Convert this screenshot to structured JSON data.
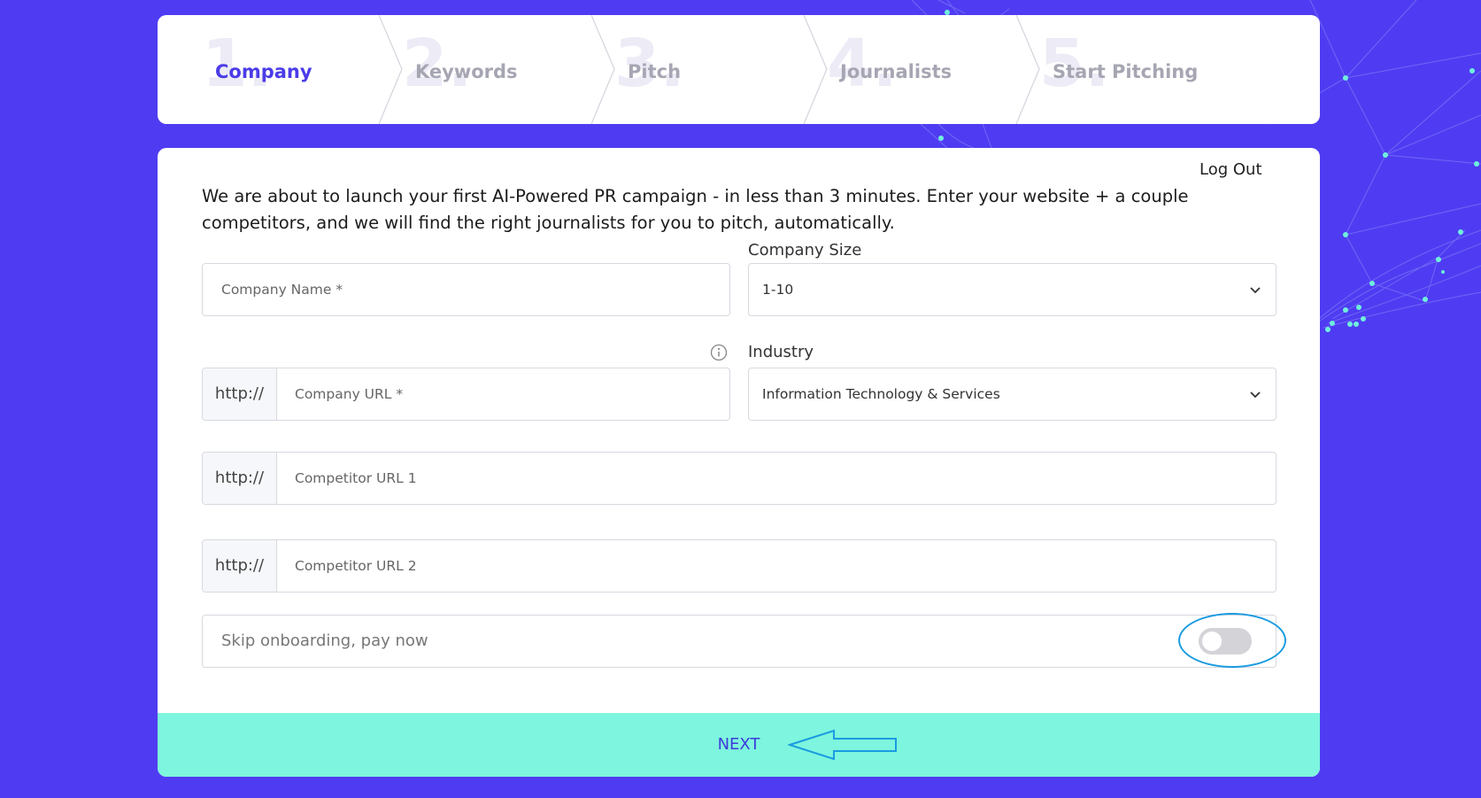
{
  "stepper": {
    "steps": [
      {
        "number": "1.",
        "label": "Company"
      },
      {
        "number": "2.",
        "label": "Keywords"
      },
      {
        "number": "3.",
        "label": "Pitch"
      },
      {
        "number": "4.",
        "label": "Journalists"
      },
      {
        "number": "5.",
        "label": "Start Pitching"
      }
    ],
    "active_step": "Company"
  },
  "header": {
    "logout_label": "Log Out"
  },
  "intro": {
    "text": "We are about to launch your first AI-Powered PR campaign - in less than 3 minutes. Enter your website + a couple competitors, and we will find the right journalists for you to pitch, automatically."
  },
  "form": {
    "company_name": {
      "placeholder": "Company Name *"
    },
    "company_size": {
      "label": "Company Size",
      "value": "1-10"
    },
    "company_url": {
      "prefix": "http://",
      "placeholder": "Company URL *"
    },
    "industry": {
      "label": "Industry",
      "value": "Information Technology & Services"
    },
    "competitor_1": {
      "prefix": "http://",
      "placeholder": "Competitor URL 1"
    },
    "competitor_2": {
      "prefix": "http://",
      "placeholder": "Competitor URL 2"
    },
    "skip": {
      "label": "Skip onboarding, pay now",
      "enabled": false
    }
  },
  "next_button": {
    "label": "NEXT"
  },
  "colors": {
    "background": "#4f3cf2",
    "accent": "#4b3ce8",
    "next_button": "#7ef5de",
    "annotation": "#1a9be0"
  },
  "icons": [
    "info-icon",
    "chevron-down-icon",
    "arrow-annotation"
  ]
}
